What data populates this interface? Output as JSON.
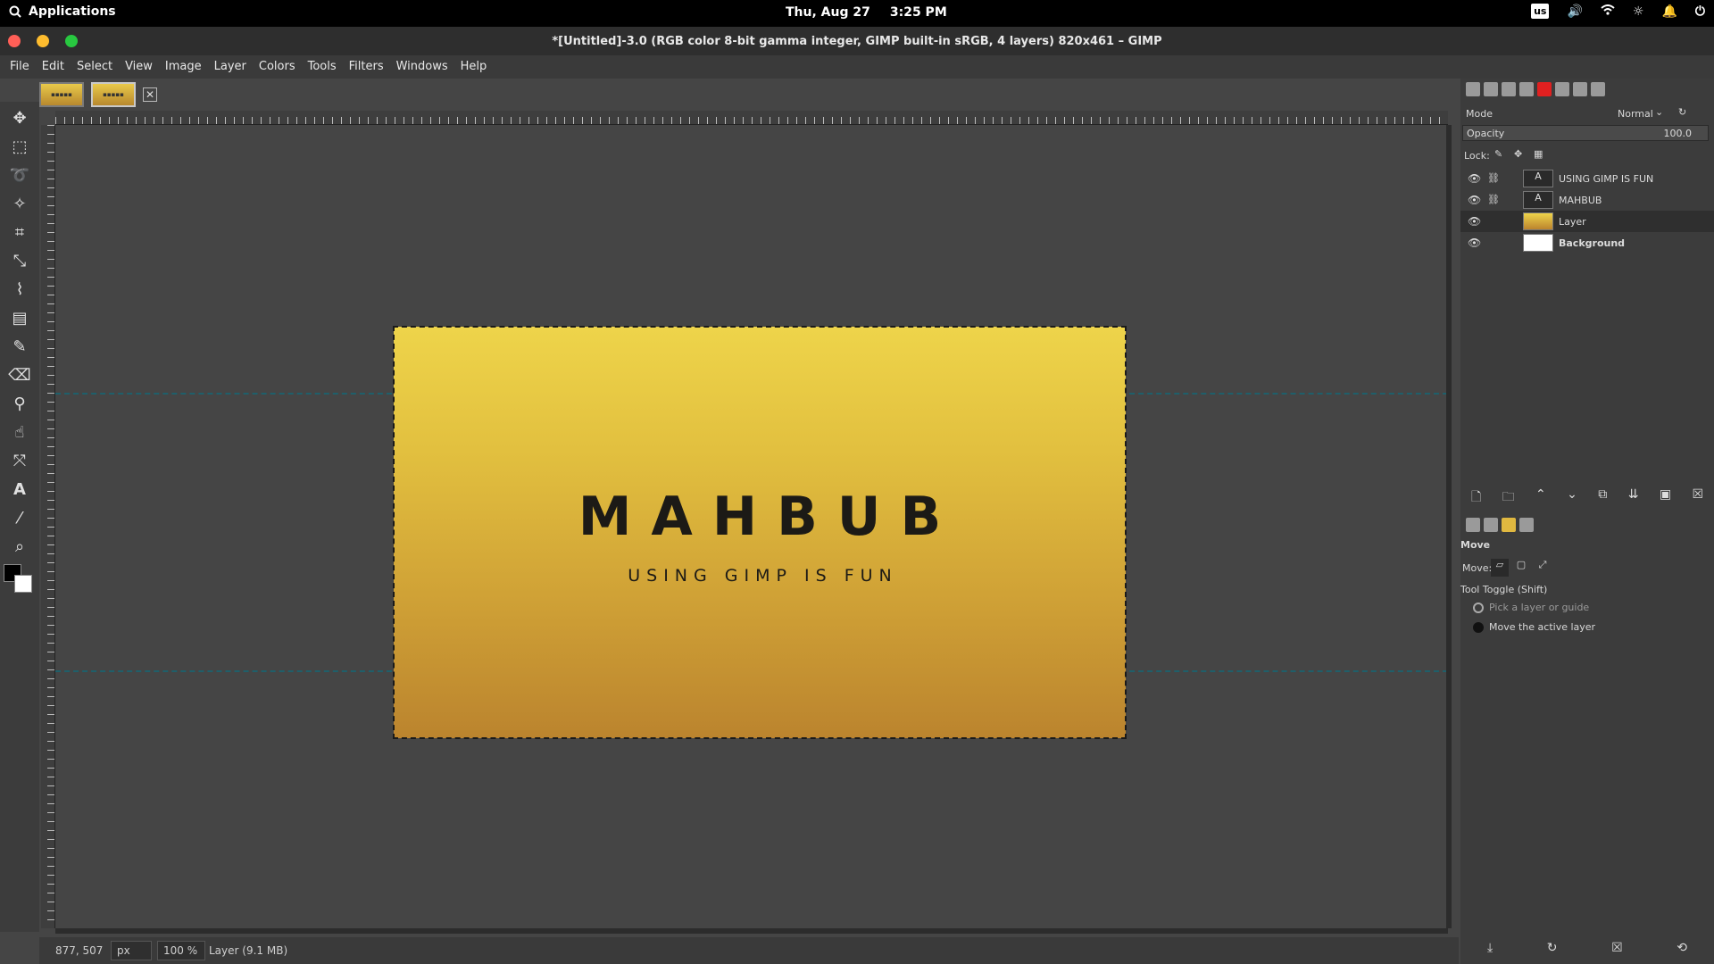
{
  "topbar": {
    "apps_label": "Applications",
    "date": "Thu, Aug 27",
    "time": "3:25 PM",
    "keyboard_layout": "us"
  },
  "window": {
    "title": "*[Untitled]-3.0 (RGB color 8-bit gamma integer, GIMP built-in sRGB, 4 layers) 820x461 – GIMP",
    "close_color": "#ff5f57",
    "minimize_color": "#febc2e",
    "maximize_color": "#28c840"
  },
  "menu": {
    "file": "File",
    "edit": "Edit",
    "select": "Select",
    "view": "View",
    "image": "Image",
    "layer": "Layer",
    "colors": "Colors",
    "tools": "Tools",
    "filters": "Filters",
    "windows": "Windows",
    "help": "Help"
  },
  "canvas": {
    "title_text": "MAHBUB",
    "subtitle_text": "USING GIMP IS FUN",
    "gradient_top": "#eed44a",
    "gradient_bottom": "#bb842e",
    "guide_color": "#1f5f6a"
  },
  "status": {
    "coords": "877, 507",
    "unit": "px",
    "zoom": "100 %",
    "message": "Layer (9.1 MB)"
  },
  "layers_panel": {
    "mode_label": "Mode",
    "mode_value": "Normal",
    "opacity_label": "Opacity",
    "opacity_value": "100.0",
    "lock_label": "Lock:",
    "layers": [
      {
        "name": "USING GIMP IS FUN",
        "type": "text"
      },
      {
        "name": "MAHBUB",
        "type": "text"
      },
      {
        "name": "Layer",
        "type": "gradient",
        "selected": true
      },
      {
        "name": "Background",
        "type": "white"
      }
    ]
  },
  "tool_options": {
    "title": "Move",
    "move_label": "Move:",
    "toggle_label": "Tool Toggle  (Shift)",
    "option_pick": "Pick a layer or guide",
    "option_move_active": "Move the active layer",
    "selected_option": "Move the active layer"
  }
}
